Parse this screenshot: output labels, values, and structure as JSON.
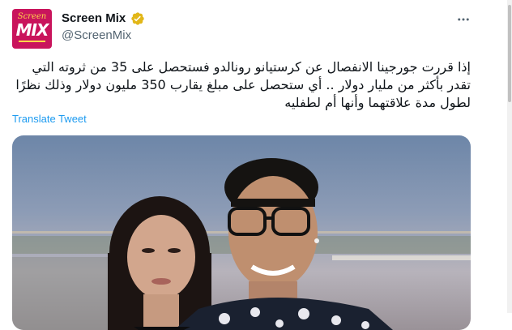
{
  "tweet": {
    "display_name": "Screen Mix",
    "handle": "@ScreenMix",
    "avatar_text": "MIX",
    "avatar_script": "Screen",
    "text": "إذا قررت جورجينا الانفصال عن كرستيانو رونالدو فستحصل على 35 من ثروته التي تقدر بأكثر من مليار دولار .. أي ستحصل على مبلغ يقارب 350 مليون دولار وذلك نظرًا لطول مدة علاقتهما وأنها أم لطفليه",
    "translate_label": "Translate Tweet",
    "more_icon": "more-horizontal-icon",
    "verified_icon": "verified-badge-icon",
    "colors": {
      "accent": "#1d9bf0",
      "verified": "#e2b719",
      "avatar_bg": "#c9145c",
      "handle": "#536471"
    }
  }
}
